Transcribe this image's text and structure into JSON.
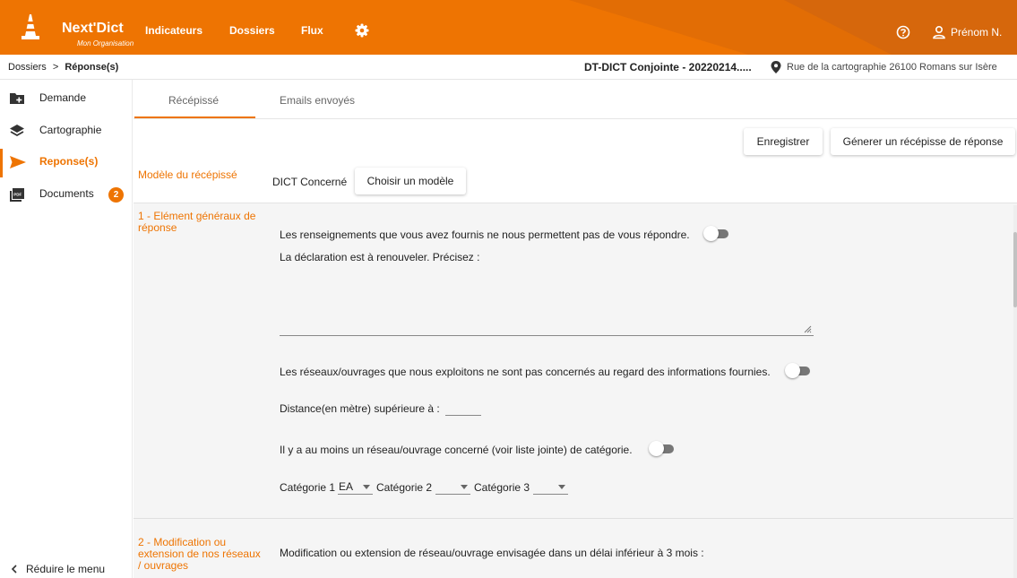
{
  "app": {
    "name": "Next'Dict",
    "organisation": "Mon Organisation",
    "brand_color": "#ee7402"
  },
  "nav": {
    "items": [
      {
        "label": "Indicateurs"
      },
      {
        "label": "Dossiers"
      },
      {
        "label": "Flux"
      }
    ],
    "settings_icon": "gear-icon",
    "help_icon": "help-circle-icon",
    "user_name": "Prénom N."
  },
  "breadcrumb": {
    "root": "Dossiers",
    "separator": ">",
    "current": "Réponse(s)"
  },
  "dossier": {
    "title": "DT-DICT Conjointe - 20220214.....",
    "address": "Rue de la cartographie 26100 Romans sur Isère"
  },
  "sidebar": {
    "items": [
      {
        "label": "Demande",
        "icon": "folder-plus-icon"
      },
      {
        "label": "Cartographie",
        "icon": "layers-icon"
      },
      {
        "label": "Reponse(s)",
        "icon": "send-icon"
      },
      {
        "label": "Documents",
        "icon": "pdf-icon",
        "badge": "2"
      }
    ],
    "reduce_label": "Réduire le menu"
  },
  "tabs": [
    {
      "label": "Récépissé",
      "active": true
    },
    {
      "label": "Emails envoyés",
      "active": false
    }
  ],
  "actions": {
    "save_label": "Enregistrer",
    "generate_label": "Génerer un récépisse de réponse"
  },
  "model": {
    "section_label": "Modèle du récépissé",
    "current": "DICT Concerné",
    "choose_label": "Choisir un modèle"
  },
  "section1": {
    "label": "1 - Elément généraux de réponse",
    "no_answer_text": "Les renseignements que vous avez fournis ne nous permettent pas de vous répondre.",
    "renew_text": "La déclaration est à renouveler. Précisez :",
    "not_concerned_text": "Les réseaux/ouvrages que nous exploitons ne sont pas concernés au regard des informations fournies.",
    "distance_label": "Distance(en mètre) supérieure à :",
    "distance_value": "",
    "concerned_text": "Il y a au moins un réseau/ouvrage concerné (voir liste jointe) de catégorie.",
    "categories": [
      {
        "label": "Catégorie 1",
        "value": "EA"
      },
      {
        "label": "Catégorie 2",
        "value": ""
      },
      {
        "label": "Catégorie 3",
        "value": ""
      }
    ]
  },
  "section2": {
    "label": "2 - Modification ou extension de nos réseaux / ouvrages",
    "text": "Modification ou extension de réseau/ouvrage envisagée dans un délai inférieur à 3 mois :"
  }
}
